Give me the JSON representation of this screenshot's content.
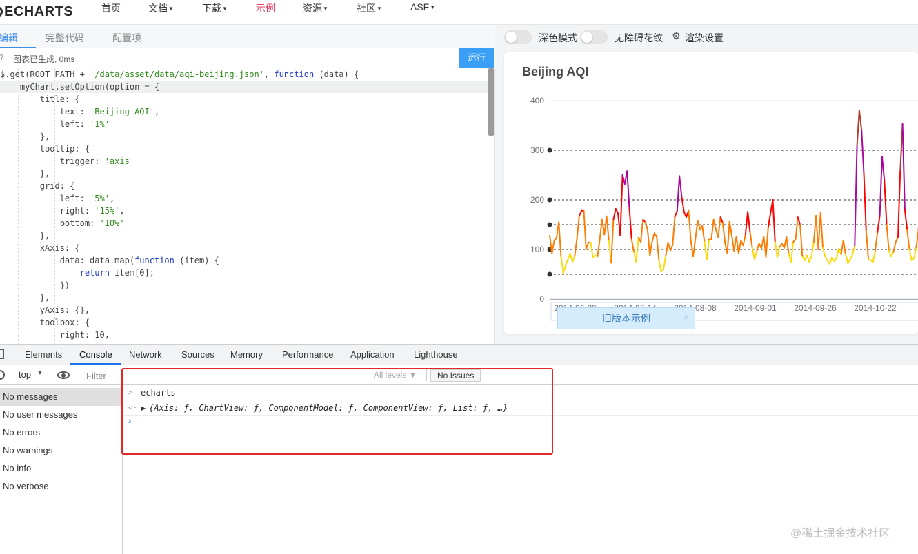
{
  "nav": {
    "logo": "ECHARTS",
    "items": [
      {
        "label": "首页",
        "caret": false
      },
      {
        "label": "文档",
        "caret": true
      },
      {
        "label": "下载",
        "caret": true
      },
      {
        "label": "示例",
        "caret": false
      },
      {
        "label": "资源",
        "caret": true
      },
      {
        "label": "社区",
        "caret": true
      },
      {
        "label": "ASF",
        "caret": true
      }
    ],
    "caret_glyph": "▼",
    "active_color": "#e43961"
  },
  "editor": {
    "tabs": [
      "编辑",
      "完整代码",
      "配置项"
    ],
    "status_number": "7",
    "status_text": "图表已生成, 0ms",
    "run_label": "运行",
    "code": [
      "$.get(ROOT_PATH + '/data/asset/data/aqi-beijing.json', function (data) {",
      "    myChart.setOption(option = {",
      "        title: {",
      "            text: 'Beijing AQI',",
      "            left: '1%'",
      "        },",
      "        tooltip: {",
      "            trigger: 'axis'",
      "        },",
      "        grid: {",
      "            left: '5%',",
      "            right: '15%',",
      "            bottom: '10%'",
      "        },",
      "        xAxis: {",
      "            data: data.map(function (item) {",
      "                return item[0];",
      "            })",
      "        },",
      "        yAxis: {},",
      "        toolbox: {",
      "            right: 10,"
    ]
  },
  "chart_pane": {
    "dark_mode_label": "深色模式",
    "a11y_label": "无障碍花纹",
    "render_settings_label": "渲染设置",
    "old_example_label": "旧版本示例",
    "old_example_close": "×"
  },
  "chart_data": {
    "type": "line",
    "title": "Beijing AQI",
    "xlabel": "",
    "ylabel": "",
    "ylim": [
      0,
      400
    ],
    "yticks": [
      0,
      100,
      200,
      300,
      400
    ],
    "x_tick_labels": [
      "2014-06-20",
      "2014-07-14",
      "2014-08-08",
      "2014-09-01",
      "2014-09-26",
      "2014-10-22"
    ],
    "mark_lines": [
      50,
      100,
      150,
      200,
      300
    ],
    "visual_map_colors": {
      "0-50": "#93CE07",
      "50-100": "#FBDB0F",
      "100-150": "#FC7D02",
      "150-200": "#FD0100",
      "200-300": "#AA069F",
      "300+": "#AC3B2A"
    },
    "series": [
      {
        "values": [
          128,
          92,
          118,
          123,
          155,
          85,
          52,
          68,
          80,
          92,
          75,
          87,
          123,
          168,
          178,
          178,
          100,
          114,
          114,
          84,
          88,
          86,
          120,
          160,
          130,
          167,
          118,
          73,
          160,
          182,
          173,
          128,
          250,
          232,
          258,
          183,
          120,
          95,
          75,
          124,
          115,
          160,
          155,
          140,
          88,
          116,
          133,
          126,
          78,
          55,
          60,
          88,
          114,
          98,
          109,
          166,
          178,
          248,
          205,
          176,
          165,
          178,
          118,
          86,
          121,
          158,
          140,
          148,
          115,
          80,
          120,
          120,
          160,
          140,
          125,
          165,
          154,
          114,
          92,
          156,
          128,
          97,
          126,
          92,
          118,
          108,
          130,
          176,
          135,
          103,
          80,
          98,
          112,
          102,
          126,
          85,
          145,
          173,
          200,
          115,
          84,
          105,
          112,
          103,
          125,
          92,
          75,
          115,
          120,
          165,
          150,
          86,
          78,
          88,
          75,
          85,
          115,
          168,
          100,
          175,
          103,
          86,
          78,
          71,
          84,
          76,
          83,
          102,
          90,
          118,
          90,
          72,
          80,
          90,
          108,
          310,
          380,
          340,
          254,
          138,
          80,
          78,
          75,
          98,
          135,
          168,
          287,
          240,
          150,
          98,
          86,
          95,
          115,
          125,
          260,
          353,
          180,
          140,
          100,
          78,
          82,
          104,
          140,
          205
        ]
      }
    ]
  },
  "devtools": {
    "tabs": [
      "Elements",
      "Console",
      "Network",
      "Sources",
      "Memory",
      "Performance",
      "Application",
      "Lighthouse"
    ],
    "context": "top",
    "context_caret": "▼",
    "filter_placeholder": "Filter",
    "levels_label": "All levels ▼",
    "issues_label": "No Issues",
    "sidebar": [
      "No messages",
      "No user messages",
      "No errors",
      "No warnings",
      "No info",
      "No verbose"
    ],
    "console": {
      "input_text": "echarts",
      "input_marker": ">",
      "result_marker": "<·",
      "result_triangle": "▶",
      "result_text": "{Axis: ƒ, ChartView: ƒ, ComponentModel: ƒ, ComponentView: ƒ, List: ƒ, …}",
      "prompt": "›"
    }
  },
  "watermark": "@稀土掘金技术社区"
}
